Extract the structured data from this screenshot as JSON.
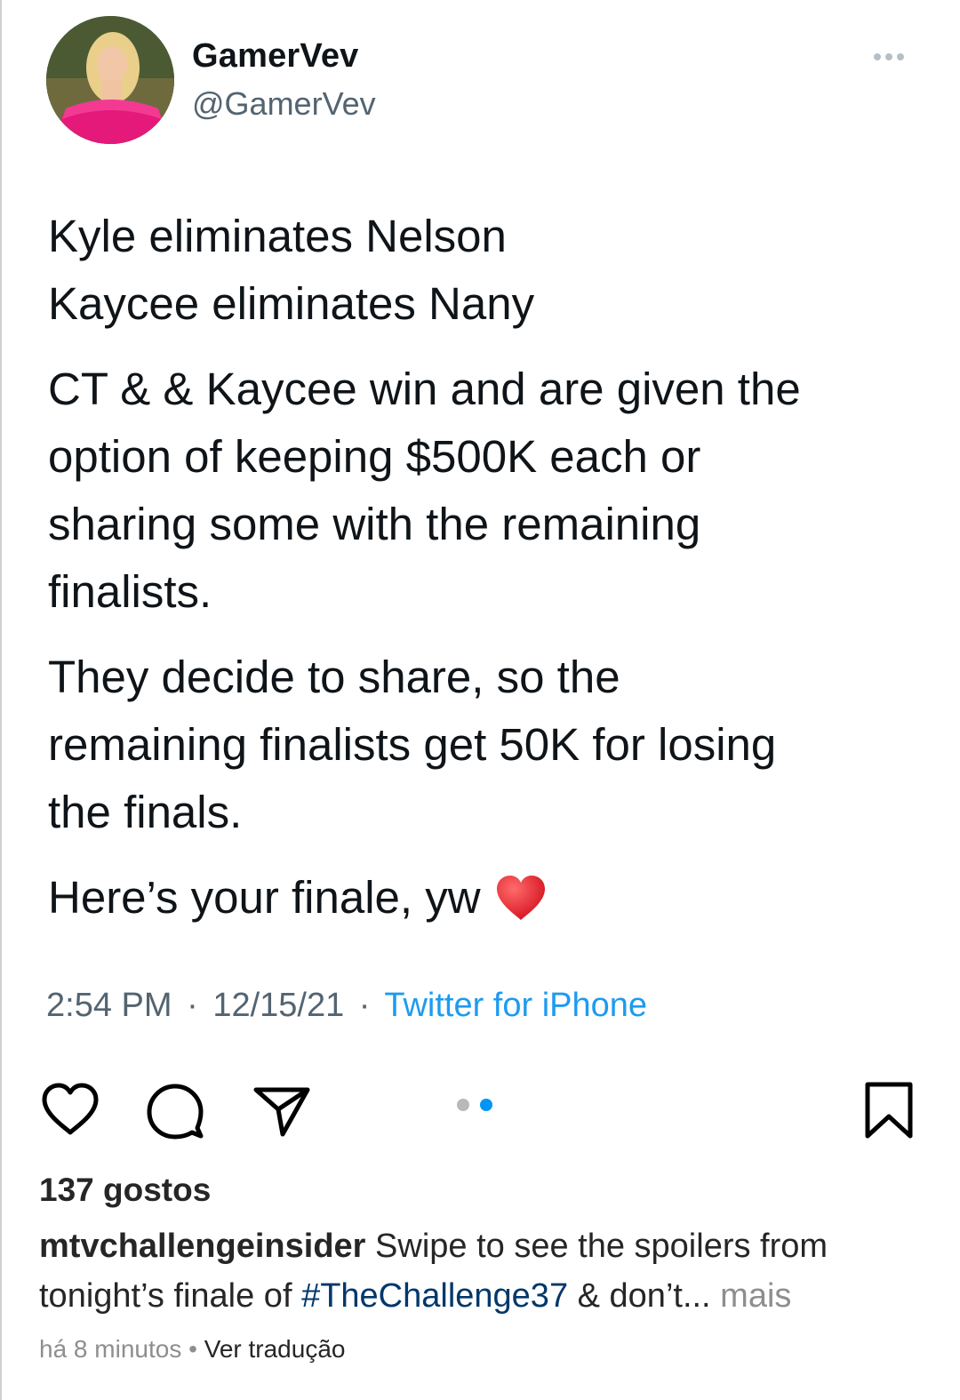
{
  "tweet": {
    "display_name": "GamerVev",
    "handle": "@GamerVev",
    "paragraphs": [
      [
        "Kyle eliminates Nelson",
        "Kaycee eliminates Nany"
      ],
      [
        "CT & & Kaycee win and are given the",
        "option of keeping $500K each or",
        "sharing some with the remaining",
        "finalists."
      ],
      [
        "They decide to share, so the",
        "remaining finalists get 50K for losing",
        "the finals."
      ],
      [
        "Here’s your finale, yw"
      ]
    ],
    "time": "2:54 PM",
    "date": "12/15/21",
    "separator": "·",
    "source": "Twitter for iPhone"
  },
  "post": {
    "likes": "137 gostos",
    "username": "mtvchallengeinsider",
    "caption_start": " Swipe to see the spoilers from tonight’s finale of ",
    "hashtag": "#TheChallenge37",
    "caption_end": " & don’t...",
    "more_label": " mais",
    "time_ago": "há 8 minutos",
    "meta_separator": " • ",
    "translate_label": "Ver tradução",
    "carousel": {
      "total": 2,
      "active_index": 1
    }
  },
  "icons": {
    "like": "heart-outline-icon",
    "comment": "comment-bubble-icon",
    "share": "paper-plane-icon",
    "save": "bookmark-icon",
    "more": "ellipsis-icon",
    "emoji": "red-heart-emoji"
  },
  "colors": {
    "link_blue": "#1d9bf0",
    "hashtag_blue": "#00376b",
    "carousel_active": "#0095f6",
    "emoji_red": "#e8202f"
  }
}
